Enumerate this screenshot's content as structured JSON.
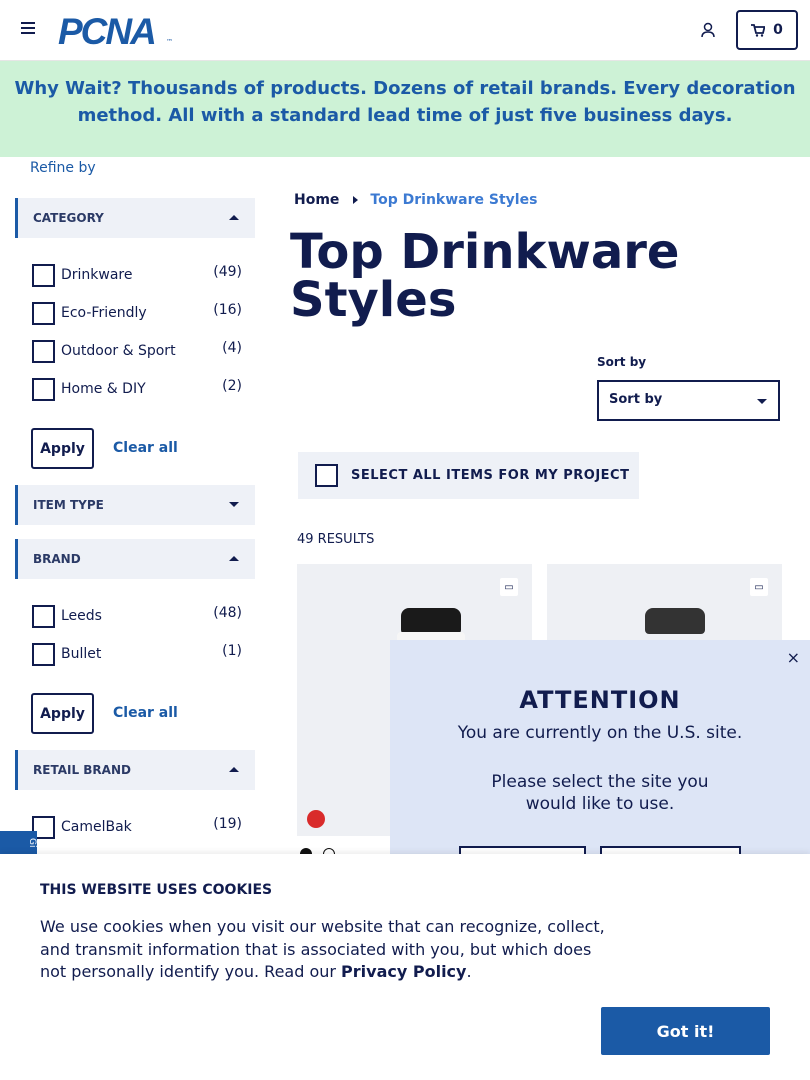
{
  "header": {
    "logo": "PCNA",
    "logo_tm": "™",
    "cart_count": "0"
  },
  "promo": {
    "lead": "Why Wait?",
    "text": " Thousands of products. Dozens of retail brands. Every decoration method. All with a standard lead time of just five business days."
  },
  "sidebar": {
    "refine_label": "Refine by",
    "apply_label": "Apply",
    "clear_label": "Clear all",
    "facets": [
      {
        "title": "CATEGORY",
        "expanded": true,
        "items": [
          {
            "label": "Drinkware",
            "count": "(49)"
          },
          {
            "label": "Eco-Friendly",
            "count": "(16)"
          },
          {
            "label": "Outdoor & Sport",
            "count": "(4)"
          },
          {
            "label": "Home & DIY",
            "count": "(2)"
          }
        ]
      },
      {
        "title": "ITEM TYPE",
        "expanded": false,
        "items": []
      },
      {
        "title": "BRAND",
        "expanded": true,
        "items": [
          {
            "label": "Leeds",
            "count": "(48)"
          },
          {
            "label": "Bullet",
            "count": "(1)"
          }
        ]
      },
      {
        "title": "RETAIL BRAND",
        "expanded": true,
        "items": [
          {
            "label": "CamelBak",
            "count": "(19)"
          }
        ]
      }
    ]
  },
  "breadcrumb": {
    "home": "Home",
    "current": "Top Drinkware Styles"
  },
  "main": {
    "title": "Top Drinkware Styles",
    "sort_label": "Sort by",
    "sort_value": "Sort by",
    "select_all_label": "SELECT ALL ITEMS FOR MY PROJECT",
    "results": "49 RESULTS"
  },
  "feedback_tab": "Gi",
  "modal": {
    "close": "×",
    "title": "ATTENTION",
    "line1": "You are currently on the U.S. site.",
    "line2": "Please select the site you",
    "line3": "would like to use."
  },
  "cookie": {
    "title": "THIS WEBSITE USES COOKIES",
    "text": "We use cookies when you visit our website that can recognize, collect, and transmit information that is associated with you, but which does not personally identify you. Read our ",
    "link": "Privacy Policy",
    "period": ".",
    "button": "Got it!"
  },
  "colors": {
    "navy": "#111c4e",
    "brand_blue": "#1b5aa6",
    "promo_bg": "#cdf2d6",
    "facet_bg": "#eef1f7",
    "modal_bg": "#dde5f6"
  }
}
